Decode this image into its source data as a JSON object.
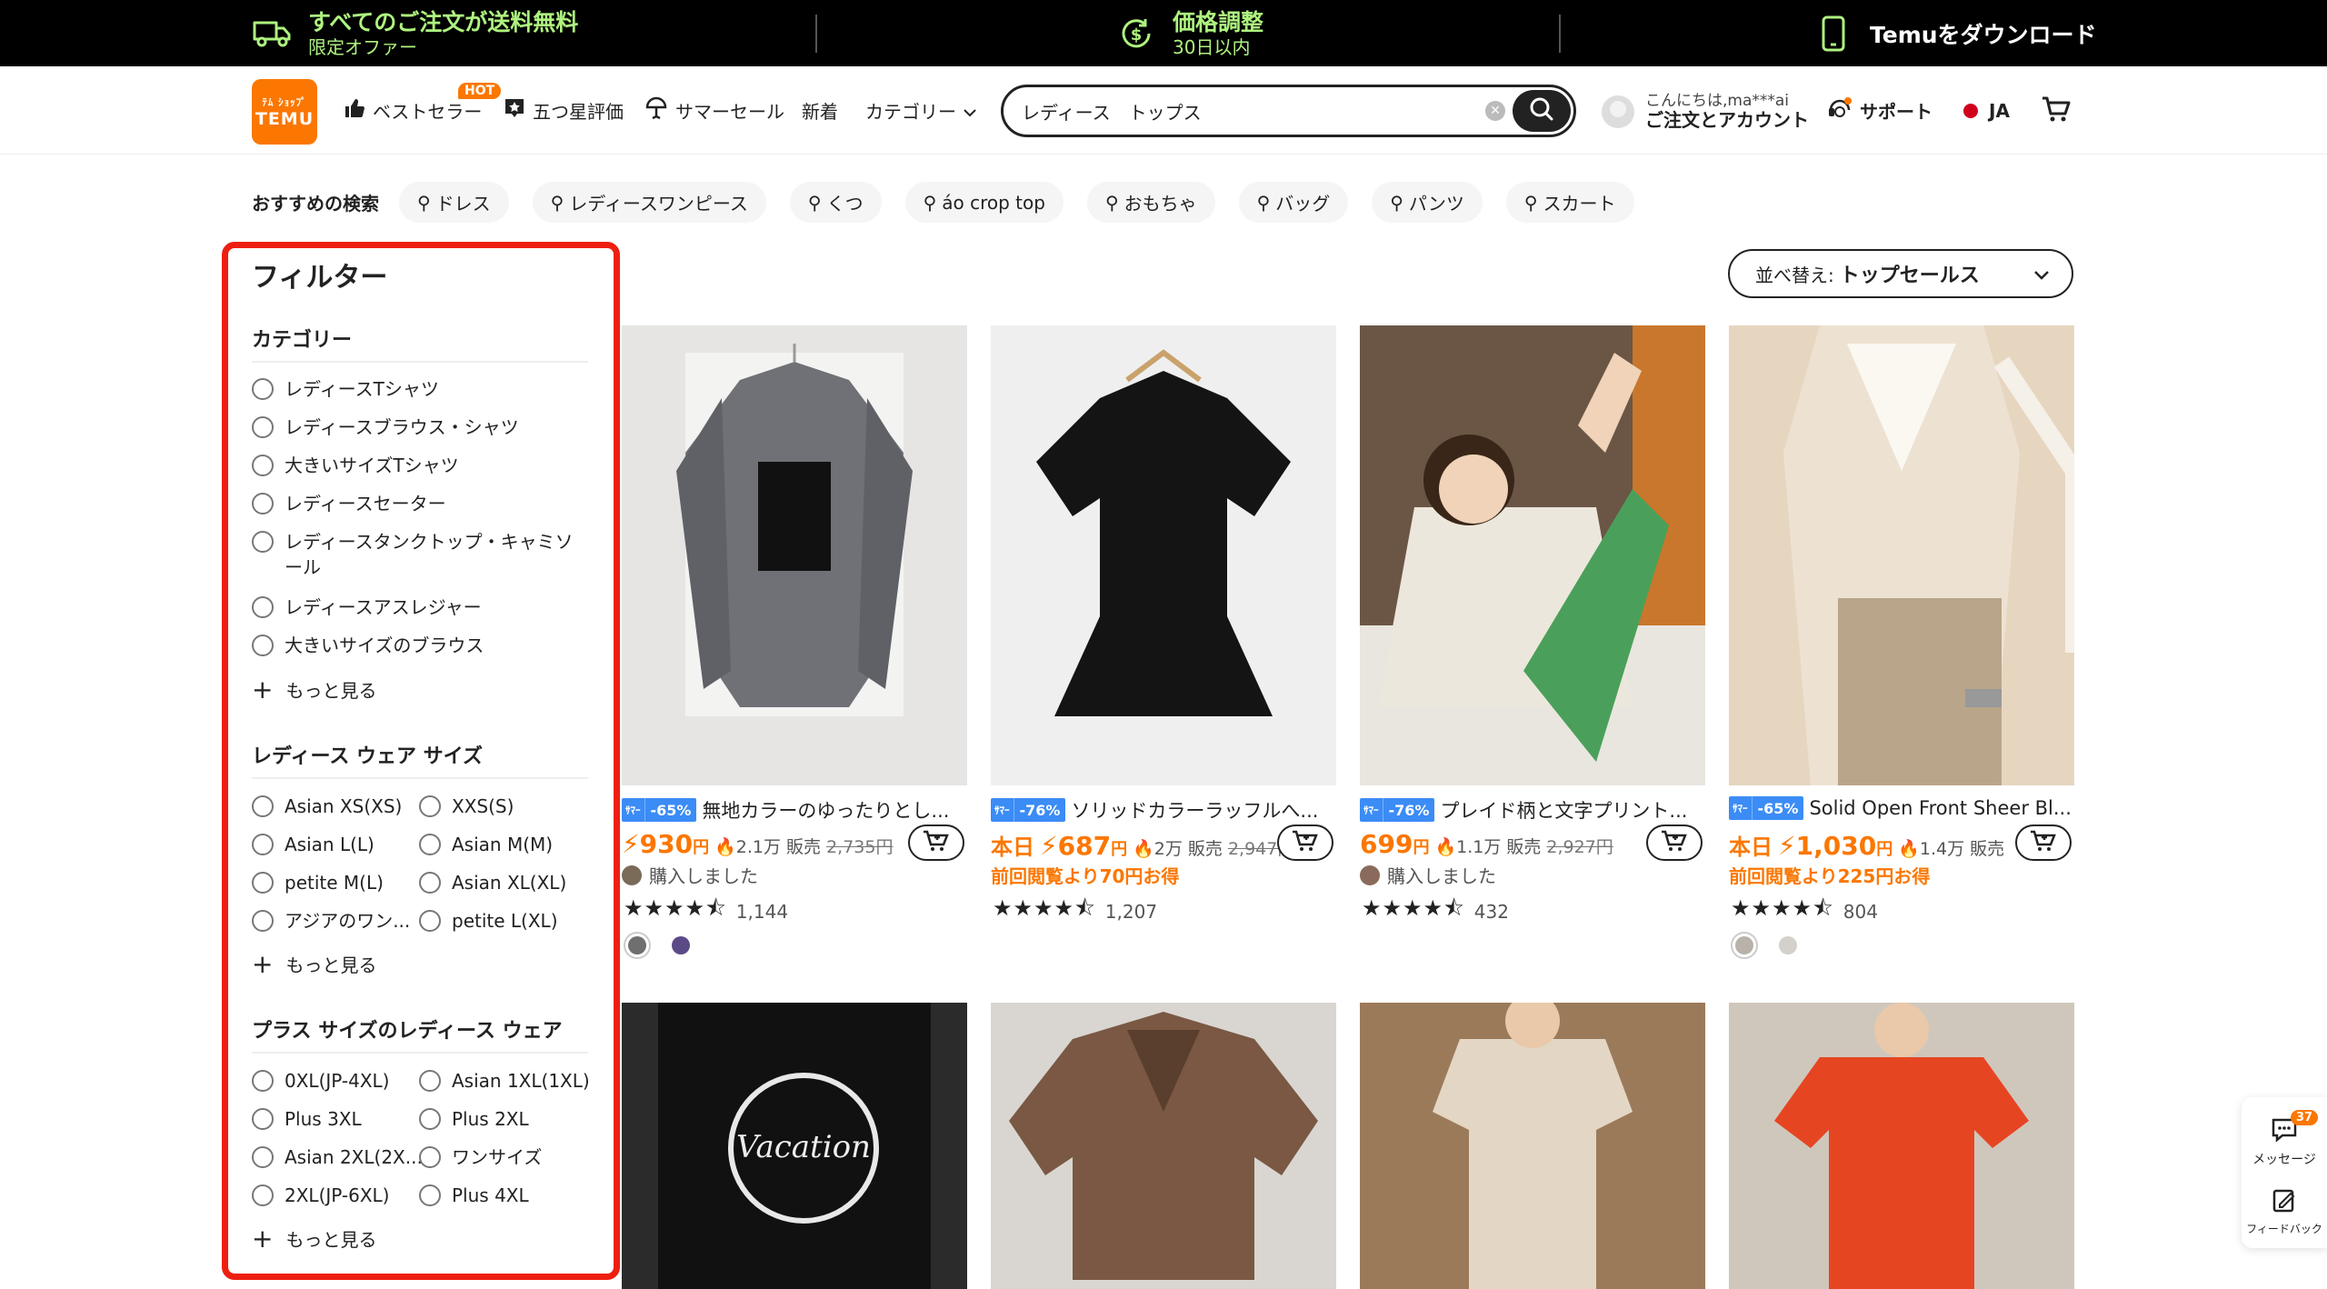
{
  "promo": {
    "shipping_main": "すべてのご注文が送料無料",
    "shipping_sub": "限定オファー",
    "price_main": "価格調整",
    "price_sub": "30日以内",
    "app": "Temuをダウンロード"
  },
  "header": {
    "logo_top": "ﾃﾑ ｼｮｯﾌﾟ",
    "logo_bottom": "TEMU",
    "nav": [
      {
        "label": "ベストセラー",
        "icon": "thumbs-up-icon",
        "badge": "HOT"
      },
      {
        "label": "五つ星評価",
        "icon": "star-badge-icon"
      },
      {
        "label": "サマーセール",
        "icon": "umbrella-icon"
      },
      {
        "label": "新着"
      },
      {
        "label": "カテゴリー",
        "icon": "chevron-down-icon"
      }
    ],
    "search_value": "レディース　トップス",
    "account_greeting": "こんにちは,ma***ai",
    "account_label": "ご注文とアカウント",
    "support": "サポート",
    "lang": "JA"
  },
  "recs": {
    "label": "おすすめの検索",
    "chips": [
      "ドレス",
      "レディースワンピース",
      "くつ",
      "áo crop top",
      "おもちゃ",
      "バッグ",
      "パンツ",
      "スカート"
    ]
  },
  "filter": {
    "title": "フィルター",
    "category": {
      "title": "カテゴリー",
      "options": [
        "レディースTシャツ",
        "レディースブラウス・シャツ",
        "大きいサイズTシャツ",
        "レディースセーター",
        "レディースタンクトップ・キャミソール",
        "レディースアスレジャー",
        "大きいサイズのブラウス"
      ],
      "more": "もっと見る"
    },
    "size": {
      "title": "レディース ウェア サイズ",
      "options": [
        "Asian XS(XS)",
        "XXS(S)",
        "Asian L(L)",
        "Asian M(M)",
        "petite M(L)",
        "Asian XL(XL)",
        "アジアのワン...",
        "petite L(XL)"
      ],
      "more": "もっと見る"
    },
    "plus": {
      "title": "プラス サイズのレディース ウェア",
      "options": [
        "0XL(JP-4XL)",
        "Asian 1XL(1XL)",
        "Plus 3XL",
        "Plus 2XL",
        "Asian 2XL(2X...",
        "ワンサイズ",
        "2XL(JP-6XL)",
        "Plus 4XL"
      ],
      "more": "もっと見る"
    }
  },
  "sort": {
    "label": "並べ替え:",
    "value": "トップセールス"
  },
  "products": [
    {
      "badge_top": "ｻﾏｰ",
      "badge_bottom": "ｾｰﾙ",
      "discount": "-65%",
      "title": "無地カラーのゆったりとし...",
      "today": "",
      "price": "930",
      "yen": "円",
      "sold": "2.1万 販売",
      "orig": "2,735円",
      "line3": "購入しました",
      "line3_type": "buyer",
      "rating": 4.5,
      "reviews": "1,144",
      "swatches": [
        "#6f6f6f",
        "#5b4a86"
      ]
    },
    {
      "badge_top": "ｻﾏｰ",
      "badge_bottom": "ｾｰﾙ",
      "discount": "-76%",
      "title": "ソリッドカラーラッフルへ...",
      "today": "本日",
      "price": "687",
      "yen": "円",
      "sold": "2万 販売",
      "orig": "2,947円",
      "line3": "前回閲覧より70円お得",
      "line3_type": "saving",
      "rating": 4.5,
      "reviews": "1,207",
      "swatches": []
    },
    {
      "badge_top": "ｻﾏｰ",
      "badge_bottom": "ｾｰﾙ",
      "discount": "-76%",
      "title": "プレイド柄と文字プリント...",
      "today": "",
      "price": "699",
      "yen": "円",
      "sold": "1.1万 販売",
      "orig": "2,927円",
      "line3": "購入しました",
      "line3_type": "buyer",
      "rating": 4.5,
      "reviews": "432",
      "swatches": []
    },
    {
      "badge_top": "ｻﾏｰ",
      "badge_bottom": "ｾｰﾙ",
      "discount": "-65%",
      "title": "Solid Open Front Sheer Bl...",
      "today": "本日",
      "price": "1,030",
      "yen": "円",
      "sold": "1.4万 販売",
      "orig": "",
      "line3": "前回閲覧より225円お得",
      "line3_type": "saving",
      "rating": 4.5,
      "reviews": "804",
      "swatches": [
        "#b8b2aa",
        "#d4d0cb"
      ]
    }
  ],
  "side": {
    "messages": "メッセージ",
    "messages_count": "37",
    "feedback": "フィードバック"
  },
  "colors": {
    "accent": "#fb7701",
    "highlight_border": "#ee1f10",
    "badge_blue": "#3b8cf6",
    "promo_green": "#aef27f"
  }
}
